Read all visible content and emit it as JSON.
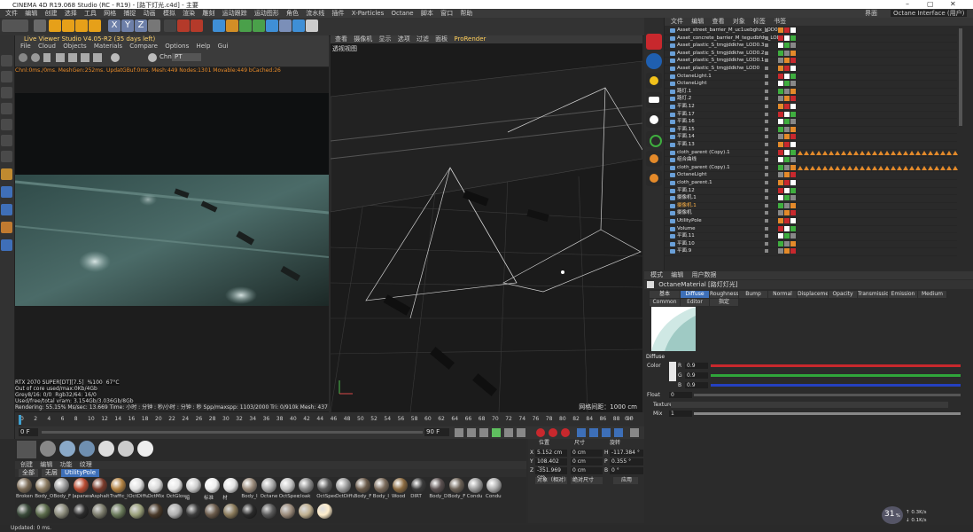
{
  "window": {
    "title": "CINEMA 4D R19.068 Studio (RC - R19) - [路下灯光.c4d] - 主要"
  },
  "menubar": [
    "文件",
    "编辑",
    "创建",
    "选择",
    "工具",
    "网格",
    "捕捉",
    "动画",
    "模拟",
    "渲染",
    "雕刻",
    "运动跟踪",
    "运动图形",
    "角色",
    "流水线",
    "插件",
    "X-Particles",
    "Octane",
    "脚本",
    "窗口",
    "帮助"
  ],
  "layout": {
    "label": "界面",
    "value": "Octane Interface (用户)"
  },
  "live_viewer": {
    "header": "Live Viewer Studio V4.05-R2 (35 days left)",
    "menu": [
      "File",
      "Cloud",
      "Objects",
      "Materials",
      "Compare",
      "Options",
      "Help",
      "Gui"
    ],
    "channel_label": "Chn:",
    "channel_value": "PT",
    "stats": "Chnl:0ms./0ms. MeshGen:252ms. UpdatGBuf:0ms. Mesh:449 Nodes:1301 Movable:449 bCached:26",
    "info": [
      "RTX 2070 SUPER[DT][7.5]",
      "%100",
      "67°C",
      "Out of core used/max:0Kb/4Gb",
      "Grey8/16: 0/0",
      "Rgb32/64: 16/0",
      "Used/free/total vram: 3.154Gb/3.036Gb/8Gb"
    ],
    "status": "Rendering: 55.15%  Ms/sec: 13.669  Time: 小时 : 分钟 : 秒/小时 : 分钟 : 秒  Spp/maxspp: 1103/2000  Tri: 0/910k  Mesh: 437  Hair: 0"
  },
  "viewport": {
    "menu": [
      "查看",
      "摄像机",
      "显示",
      "选项",
      "过滤",
      "面板",
      "ProRender"
    ],
    "label": "透视视图",
    "grid_spacing": "网格间距：1000 cm"
  },
  "timeline": {
    "ticks": [
      "0",
      "2",
      "4",
      "6",
      "8",
      "10",
      "12",
      "14",
      "16",
      "18",
      "20",
      "22",
      "24",
      "26",
      "28",
      "30",
      "32",
      "34",
      "36",
      "38",
      "40",
      "42",
      "44",
      "46",
      "48",
      "50",
      "52",
      "54",
      "56",
      "58",
      "60",
      "62",
      "64",
      "66",
      "68",
      "70",
      "72",
      "74",
      "76",
      "78",
      "80",
      "82",
      "84",
      "86",
      "88",
      "90"
    ],
    "frame_end": "0 F",
    "current": "0 F",
    "max": "90 F",
    "right_field": "90 F"
  },
  "materials": {
    "menu": [
      "创建",
      "编辑",
      "功能",
      "纹理"
    ],
    "tabs": [
      "全部",
      "无层",
      "UtilityPole"
    ],
    "row1": [
      "Broken",
      "Body_O",
      "Body_F",
      "Japanese",
      "Asphalt",
      "Traffic_l",
      "OctDiffu",
      "OctMix",
      "OctGlos",
      "暗",
      "标准",
      "材",
      "Body_I",
      "Octane",
      "OctSpec",
      "cloak",
      "OctSpec",
      "OctDiffu",
      "Body_F",
      "Body_l",
      "Wood",
      "DIRT",
      "Body_D",
      "Body_F",
      "Condu",
      "Condu"
    ],
    "row2": [
      "",
      "",
      "",
      "",
      "",
      "",
      "",
      "",
      "",
      "",
      "",
      "",
      "",
      "",
      "",
      "",
      ""
    ]
  },
  "coords": {
    "headers": [
      "位置",
      "尺寸",
      "旋转"
    ],
    "rows": [
      {
        "axis": "X",
        "pos": "5.152 cm",
        "size": "0 cm",
        "rlabel": "H",
        "rot": "-117.384 °"
      },
      {
        "axis": "Y",
        "pos": "108.402 cm",
        "size": "0 cm",
        "rlabel": "P",
        "rot": "0.355 °"
      },
      {
        "axis": "Z",
        "pos": "-351.969 cm",
        "size": "0 cm",
        "rlabel": "B",
        "rot": "0 °"
      }
    ],
    "mode1": "对象（相对）",
    "mode2": "绝对尺寸",
    "apply": "应用"
  },
  "object_manager": {
    "menu": [
      "文件",
      "编辑",
      "查看",
      "对象",
      "标签",
      "书签"
    ],
    "rows": [
      "Asset_street_barrier_M_uc1uebghx_LOD0",
      "Asset_concrete_barrier_M_tegudbfdw_LOD0",
      "Asset_plastic_S_tmgjddkhw_LOD0.3",
      "Asset_plastic_S_tmgjddkhw_LOD0.2",
      "Asset_plastic_S_tmgjddkhw_LOD0.1",
      "Asset_plastic_S_tmgjddkhw_LOD0",
      "OctaneLight.1",
      "OctaneLight",
      "路灯.1",
      "路灯.2",
      "平面.12",
      "平面.17",
      "平面.16",
      "平面.15",
      "平面.14",
      "平面.13",
      "cloth_parent (Copy).1",
      "组合曲线",
      "cloth_parent (Copy).1",
      "OctaneLight",
      "cloth_parent.1",
      "平面.12",
      "摄像机.1",
      "摄像机.1",
      "摄像机",
      "UtilityPole",
      "Volume",
      "平面.11",
      "平面.10",
      "平面.9"
    ]
  },
  "attributes": {
    "menu": [
      "模式",
      "编辑",
      "用户数据"
    ],
    "material_name": "OctaneMaterial [路灯灯光]",
    "tabs_row1": [
      "基本",
      "Diffuse",
      "Roughness",
      "Bump",
      "Normal",
      "Displacement",
      "Opacity",
      "Transmission",
      "Emission",
      "Medium"
    ],
    "tabs_row2": [
      "Common",
      "Editor",
      "指定"
    ],
    "section": "Diffuse",
    "color_label": "Color",
    "r": "0.9",
    "g": "0.9",
    "b": "0.9",
    "float_label": "Float",
    "float_value": "0",
    "texture_label": "Texture",
    "mix_label": "Mix",
    "mix_value": "1"
  },
  "status": {
    "text": "Updated: 0 ms."
  },
  "perf": {
    "value": "31",
    "unit": "%",
    "up": "0.3",
    "down": "0.1",
    "speed_unit": "K/s"
  },
  "colors": {
    "accent": "#3d6fb8",
    "warning": "#e47b1f",
    "red": "#c8282d",
    "orange": "#e48a2a"
  }
}
